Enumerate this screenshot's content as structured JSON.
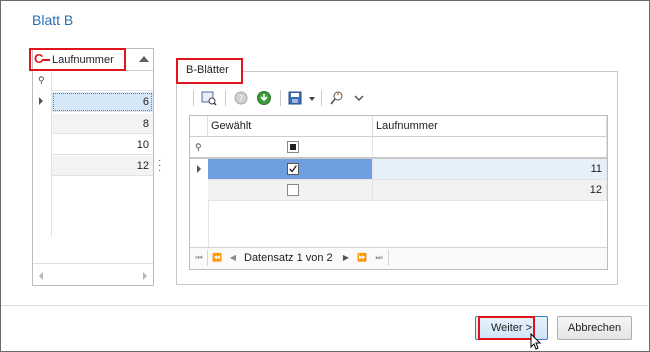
{
  "window": {
    "title": "Blatt B"
  },
  "left_grid": {
    "marker": "C",
    "column_header": "Laufnummer",
    "rows": [
      "6",
      "8",
      "10",
      "12"
    ],
    "selected_row_index": 0
  },
  "group": {
    "title": "B-Blätter",
    "toolbar_icons": [
      "view-icon",
      "info-icon",
      "refresh-icon",
      "save-icon",
      "dropdown-arrow-icon",
      "filter-icon",
      "chevron-down-icon"
    ]
  },
  "right_grid": {
    "columns": [
      "Gewählt",
      "Laufnummer"
    ],
    "rows": [
      {
        "checked": true,
        "laufnummer": "11"
      },
      {
        "checked": false,
        "laufnummer": "12"
      }
    ],
    "navigator_text": "Datensatz 1 von 2"
  },
  "buttons": {
    "next": "Weiter >",
    "cancel": "Abbrechen"
  },
  "colors": {
    "title": "#2a6fb0",
    "highlight": "#e0151c",
    "selected_row": "#6f9fe1",
    "selected_cell": "#d6e8f8"
  }
}
